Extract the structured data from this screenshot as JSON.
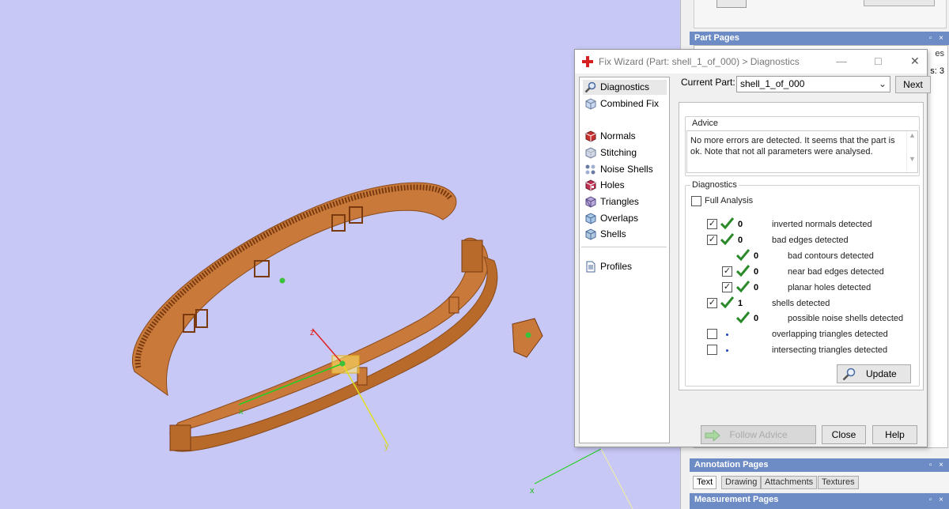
{
  "right_panel": {
    "part_pages_title": "Part Pages",
    "part_pages_count_fragment": "s: 3",
    "part_pages_tab_fragment": "es",
    "annotation_pages_title": "Annotation Pages",
    "annotation_tabs": [
      "Text",
      "Drawing",
      "Attachments",
      "Textures"
    ],
    "measurement_pages_title": "Measurement Pages",
    "panel_controls": "▫ ×"
  },
  "viewport": {
    "axis_labels": {
      "x": "x",
      "y": "y",
      "z": "z",
      "x2": "x"
    }
  },
  "dialog": {
    "title": "Fix Wizard (Part: shell_1_of_000) > Diagnostics",
    "titlebar_buttons": {
      "minimize": "—",
      "maximize": "☐",
      "close": "✕"
    },
    "nav": [
      {
        "label": "Diagnostics",
        "icon": "magnifier-icon"
      },
      {
        "label": "Combined Fix",
        "icon": "cube-icon"
      },
      {
        "label": "Normals",
        "icon": "normals-cube-icon"
      },
      {
        "label": "Stitching",
        "icon": "stitching-cube-icon"
      },
      {
        "label": "Noise Shells",
        "icon": "noise-shells-icon"
      },
      {
        "label": "Holes",
        "icon": "holes-cube-icon"
      },
      {
        "label": "Triangles",
        "icon": "triangles-cube-icon"
      },
      {
        "label": "Overlaps",
        "icon": "overlaps-cube-icon"
      },
      {
        "label": "Shells",
        "icon": "shells-cube-icon"
      },
      {
        "label": "Profiles",
        "icon": "profiles-doc-icon"
      }
    ],
    "current_part_label": "Current Part:",
    "current_part_value": "shell_1_of_000",
    "next_label": "Next",
    "advice_label": "Advice",
    "advice_text": "No more errors are detected. It seems that the part is ok. Note that not all parameters were analysed.",
    "diagnostics_label": "Diagnostics",
    "full_analysis_label": "Full Analysis",
    "full_analysis_checked": false,
    "rows": [
      {
        "checked": true,
        "status": "ok",
        "count": "0",
        "label": "inverted normals detected"
      },
      {
        "checked": true,
        "status": "ok",
        "count": "0",
        "label": "bad edges detected"
      },
      {
        "checked": null,
        "status": "ok",
        "count": "0",
        "label": "bad contours detected"
      },
      {
        "checked": true,
        "status": "ok",
        "count": "0",
        "label": "near bad edges detected"
      },
      {
        "checked": true,
        "status": "ok",
        "count": "0",
        "label": "planar holes detected"
      },
      {
        "checked": true,
        "status": "ok",
        "count": "1",
        "label": "shells detected"
      },
      {
        "checked": null,
        "status": "ok",
        "count": "0",
        "label": "possible noise shells detected"
      },
      {
        "checked": false,
        "status": "not-run",
        "count": "",
        "label": "overlapping triangles detected"
      },
      {
        "checked": false,
        "status": "not-run",
        "count": "",
        "label": "intersecting triangles detected"
      }
    ],
    "update_label": "Update",
    "follow_advice_label": "Follow Advice",
    "close_label": "Close",
    "help_label": "Help"
  },
  "colors": {
    "viewport_bg": "#c8c8f6",
    "part_fill": "#c97a3a",
    "panel_header": "#6d8bc4",
    "check_green": "#2a8a2a"
  }
}
